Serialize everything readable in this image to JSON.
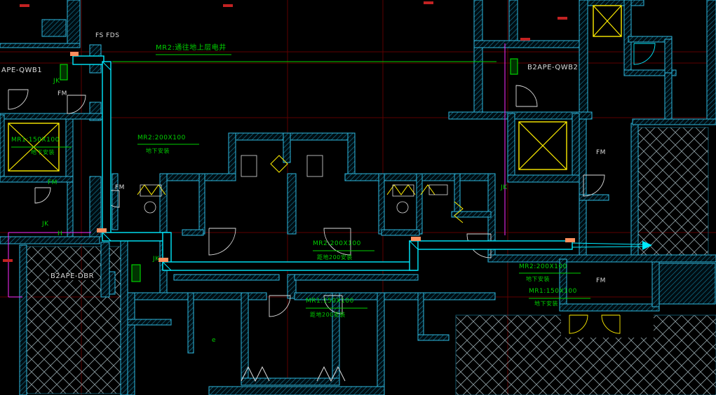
{
  "labels": {
    "fs_fds": "FS FDS",
    "mr2_riser": "MR2:通往地上层电井",
    "panel_left": "APE-QWB1",
    "panel_right": "B2APE-QWB2",
    "panel_dbr": "B2APE-DBR",
    "jk": "JK",
    "h": "H",
    "fm": "FM",
    "e": "e",
    "mr1_size": "MR1:150X100",
    "mr2_size": "MR2:200X100",
    "install_below": "地下安装",
    "install_height": "距地200安装"
  },
  "colors": {
    "background": "#000000",
    "wall_hatch": "#157e9e",
    "wall_edge": "#2eb8de",
    "tray_cyan": "#00eaff",
    "annotation_green": "#00cf00",
    "grid_red": "#5e0000",
    "magenta": "#ff2bff",
    "yellow": "#ffee00",
    "white": "#dcdcdc",
    "orange": "#ff8f5e",
    "red_mark": "#c22222",
    "void_line": "#8fa0a6"
  }
}
